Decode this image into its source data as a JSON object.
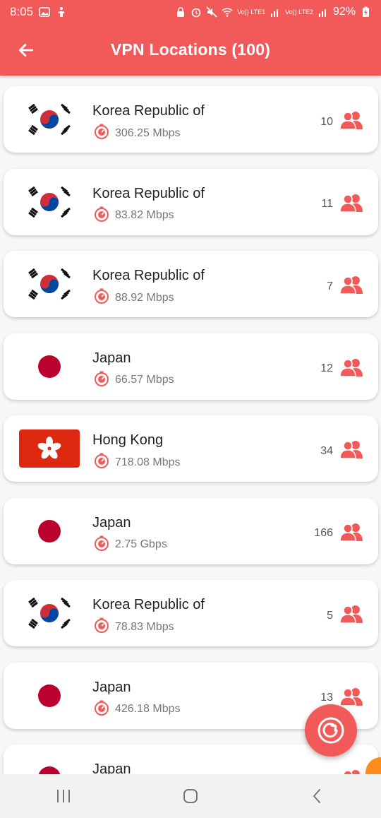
{
  "status_bar": {
    "time": "8:05",
    "battery": "92%",
    "sim1": "Vo)) LTE1",
    "sim2": "Vo)) LTE2"
  },
  "header": {
    "title": "VPN Locations (100)",
    "back_icon": "arrow-left-icon"
  },
  "servers": [
    {
      "country": "Korea Republic of",
      "speed": "306.25 Mbps",
      "users": "10",
      "flag": "kr"
    },
    {
      "country": "Korea Republic of",
      "speed": "83.82 Mbps",
      "users": "11",
      "flag": "kr"
    },
    {
      "country": "Korea Republic of",
      "speed": "88.92 Mbps",
      "users": "7",
      "flag": "kr"
    },
    {
      "country": "Japan",
      "speed": "66.57 Mbps",
      "users": "12",
      "flag": "jp"
    },
    {
      "country": "Hong Kong",
      "speed": "718.08 Mbps",
      "users": "34",
      "flag": "hk"
    },
    {
      "country": "Japan",
      "speed": "2.75 Gbps",
      "users": "166",
      "flag": "jp"
    },
    {
      "country": "Korea Republic of",
      "speed": "78.83 Mbps",
      "users": "5",
      "flag": "kr"
    },
    {
      "country": "Japan",
      "speed": "426.18 Mbps",
      "users": "13",
      "flag": "jp"
    },
    {
      "country": "Japan",
      "speed": "",
      "users": "",
      "flag": "jp"
    }
  ],
  "fab": {
    "icon": "refresh-icon"
  },
  "colors": {
    "accent": "#f25a5a",
    "card": "#ffffff",
    "background": "#f7f7f7"
  }
}
